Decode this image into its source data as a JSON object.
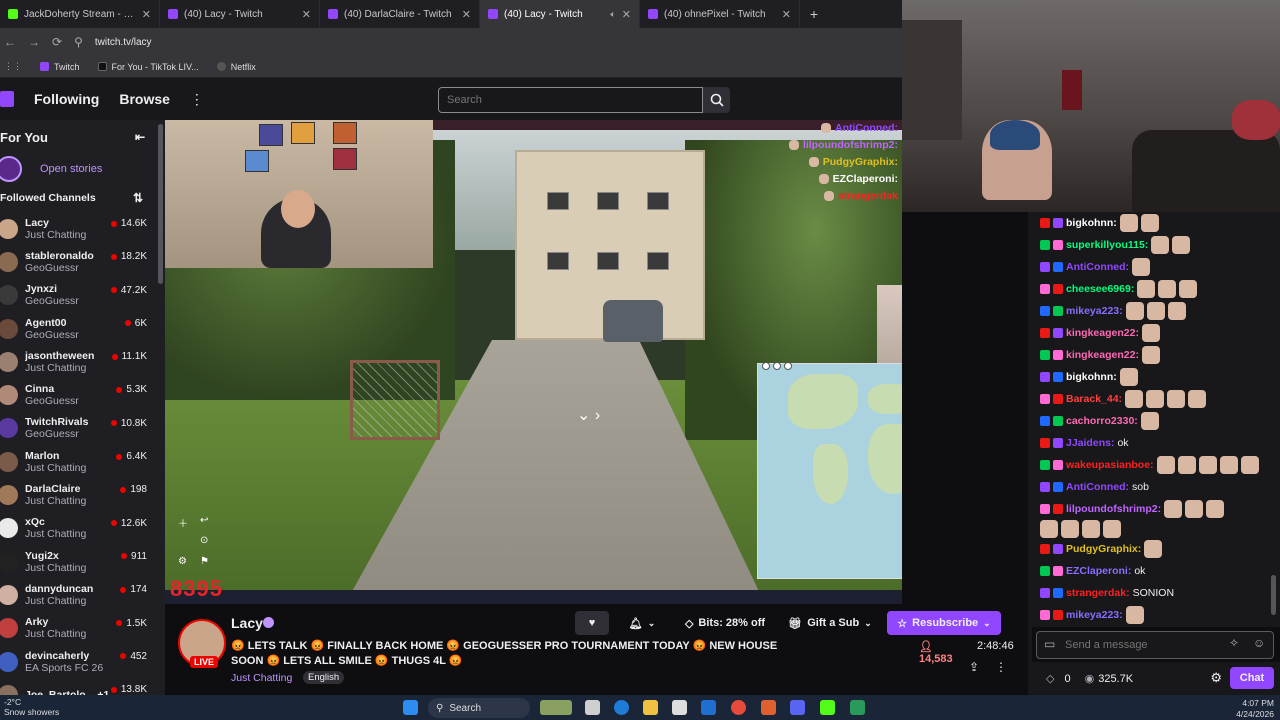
{
  "browser": {
    "tabs": [
      {
        "title": "JackDoherty Stream - Watch Li...",
        "kind": "kick",
        "active": false
      },
      {
        "title": "(40) Lacy - Twitch",
        "kind": "twitch",
        "active": false
      },
      {
        "title": "(40) DarlaClaire - Twitch",
        "kind": "twitch",
        "active": false
      },
      {
        "title": "(40) Lacy - Twitch",
        "kind": "twitch",
        "active": true
      },
      {
        "title": "(40) ohnePixel - Twitch",
        "kind": "twitch",
        "active": false
      }
    ],
    "url": "twitch.tv/lacy",
    "bookmarks": [
      "Twitch",
      "For You - TikTok LIV...",
      "Netflix"
    ]
  },
  "topnav": {
    "following": "Following",
    "browse": "Browse",
    "search_placeholder": "Search"
  },
  "sidebar": {
    "for_you": "For You",
    "open_stories": "Open stories",
    "followed_channels": "Followed Channels",
    "channels": [
      {
        "name": "Lacy",
        "game": "Just Chatting",
        "viewers": "14.6K"
      },
      {
        "name": "stableronaldo",
        "game": "GeoGuessr",
        "viewers": "18.2K"
      },
      {
        "name": "Jynxzi",
        "game": "GeoGuessr",
        "viewers": "47.2K"
      },
      {
        "name": "Agent00",
        "game": "GeoGuessr",
        "viewers": "6K"
      },
      {
        "name": "jasontheween",
        "game": "Just Chatting",
        "viewers": "11.1K"
      },
      {
        "name": "Cinna",
        "game": "GeoGuessr",
        "viewers": "5.3K"
      },
      {
        "name": "TwitchRivals",
        "game": "GeoGuessr",
        "viewers": "10.8K"
      },
      {
        "name": "Marlon",
        "game": "Just Chatting",
        "viewers": "6.4K"
      },
      {
        "name": "DarlaClaire",
        "game": "Just Chatting",
        "viewers": "198"
      },
      {
        "name": "xQc",
        "game": "Just Chatting",
        "viewers": "12.6K"
      },
      {
        "name": "Yugi2x",
        "game": "Just Chatting",
        "viewers": "911"
      },
      {
        "name": "dannyduncan",
        "game": "Just Chatting",
        "viewers": "174"
      },
      {
        "name": "Arky",
        "game": "Just Chatting",
        "viewers": "1.5K"
      },
      {
        "name": "devincaherly",
        "game": "EA Sports FC 26",
        "viewers": "452"
      },
      {
        "name": "Joe_Bartolo... +1",
        "game": "",
        "viewers": "13.8K"
      }
    ]
  },
  "player": {
    "overlay_count": "8395",
    "overlay_chat": [
      {
        "user": "AntiConned:",
        "color": "#9147ff"
      },
      {
        "user": "lilpoundofshrimp2:",
        "color": "#c065ff"
      },
      {
        "user": "PudgyGraphix:",
        "color": "#e0c020"
      },
      {
        "user": "EZClaperoni:",
        "color": "#ffffff"
      },
      {
        "user": "strangerdak",
        "color": "#ff2020"
      }
    ]
  },
  "stream": {
    "streamer": "Lacy",
    "live": "LIVE",
    "title": "😡 LETS TALK 😡 FINALLY BACK HOME 😡 GEOGUESSER PRO TOURNAMENT TODAY 😡 NEW HOUSE SOON 😡 LETS ALL SMILE 😡 THUGS 4L 😡",
    "category": "Just Chatting",
    "language": "English",
    "bits": "Bits: 28% off",
    "gift": "Gift a Sub",
    "resub": "Resubscribe",
    "viewers": "14,583",
    "uptime": "2:48:46"
  },
  "chat": {
    "messages": [
      {
        "user": "bigkohnn:",
        "color": "#ffffff",
        "text": "",
        "emotes": 2
      },
      {
        "user": "superkillyou115:",
        "color": "#00ff7f",
        "text": "",
        "emotes": 2
      },
      {
        "user": "AntiConned:",
        "color": "#9147ff",
        "text": "",
        "emotes": 1
      },
      {
        "user": "cheesee6969:",
        "color": "#00ff7f",
        "text": "",
        "emotes": 3
      },
      {
        "user": "mikeya223:",
        "color": "#8a6cff",
        "text": "",
        "emotes": 3
      },
      {
        "user": "kingkeagen22:",
        "color": "#ff69b4",
        "text": "",
        "emotes": 1
      },
      {
        "user": "kingkeagen22:",
        "color": "#ff69b4",
        "text": "",
        "emotes": 1
      },
      {
        "user": "bigkohnn:",
        "color": "#ffffff",
        "text": "",
        "emotes": 1
      },
      {
        "user": "Barack_44:",
        "color": "#ff4040",
        "text": "",
        "emotes": 4
      },
      {
        "user": "cachorro2330:",
        "color": "#ff69b4",
        "text": "",
        "emotes": 1
      },
      {
        "user": "JJaidens:",
        "color": "#9147ff",
        "text": "ok",
        "emotes": 0
      },
      {
        "user": "wakeupasianboe:",
        "color": "#ff2020",
        "text": "",
        "emotes": 5
      },
      {
        "user": "AntiConned:",
        "color": "#9147ff",
        "text": "sob",
        "emotes": 0
      },
      {
        "user": "lilpoundofshrimp2:",
        "color": "#c065ff",
        "text": "",
        "emotes": 3
      },
      {
        "user": "",
        "color": "#c065ff",
        "text": "",
        "emotes": 4
      },
      {
        "user": "PudgyGraphix:",
        "color": "#e0c020",
        "text": "",
        "emotes": 1
      },
      {
        "user": "EZClaperoni:",
        "color": "#8a6cff",
        "text": "ok",
        "emotes": 0
      },
      {
        "user": "strangerdak:",
        "color": "#ff2020",
        "text": "SONION",
        "emotes": 0
      },
      {
        "user": "mikeya223:",
        "color": "#8a6cff",
        "text": "",
        "emotes": 1
      }
    ],
    "input_placeholder": "Send a message",
    "points": "0",
    "channel_points": "325.7K",
    "chat_button": "Chat"
  },
  "taskbar": {
    "temp": "-2°C",
    "weather": "Snow showers",
    "search": "Search",
    "time": "4:07 PM",
    "date": "4/24/2026"
  }
}
